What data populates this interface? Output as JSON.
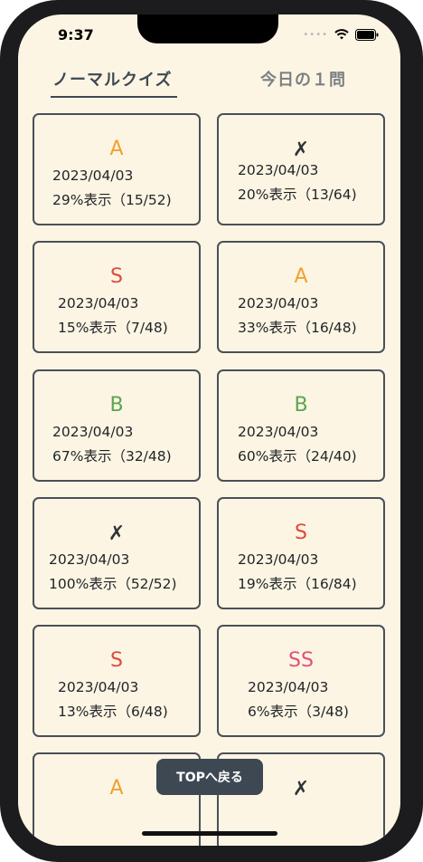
{
  "status": {
    "time": "9:37",
    "signal_icon": "signal-dots-icon",
    "wifi_icon": "wifi-icon",
    "battery_icon": "battery-icon"
  },
  "tabs": [
    {
      "label": "ノーマルクイズ",
      "selected": true
    },
    {
      "label": "今日の１問",
      "selected": false
    }
  ],
  "grade_colors": {
    "A": "#f0a030",
    "S": "#e04a3a",
    "B": "#5aa550",
    "SS": "#e0507a",
    "✗": "#2f3338"
  },
  "results": [
    {
      "grade": "A",
      "date": "2023/04/03",
      "percent": "29%表示（15/52)"
    },
    {
      "grade": "✗",
      "date": "2023/04/03",
      "percent": "20%表示（13/64)"
    },
    {
      "grade": "S",
      "date": "2023/04/03",
      "percent": "15%表示（7/48)"
    },
    {
      "grade": "A",
      "date": "2023/04/03",
      "percent": "33%表示（16/48)"
    },
    {
      "grade": "B",
      "date": "2023/04/03",
      "percent": "67%表示（32/48)"
    },
    {
      "grade": "B",
      "date": "2023/04/03",
      "percent": "60%表示（24/40)"
    },
    {
      "grade": "✗",
      "date": "2023/04/03",
      "percent": "100%表示（52/52)"
    },
    {
      "grade": "S",
      "date": "2023/04/03",
      "percent": "19%表示（16/84)"
    },
    {
      "grade": "S",
      "date": "2023/04/03",
      "percent": "13%表示（6/48)"
    },
    {
      "grade": "SS",
      "date": "2023/04/03",
      "percent": "6%表示（3/48)"
    },
    {
      "grade": "A"
    },
    {
      "grade": "✗"
    }
  ],
  "bottom_button": {
    "label": "TOPへ戻る"
  }
}
